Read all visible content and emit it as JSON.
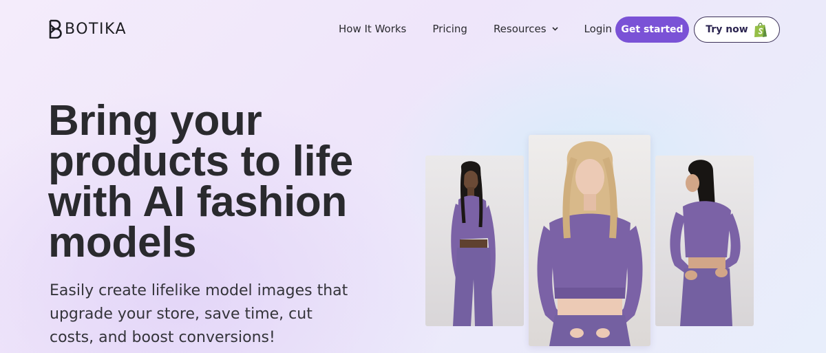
{
  "brand": {
    "name": "BOTIKA",
    "logo_icon": "botika-b-icon"
  },
  "nav": {
    "links": [
      {
        "label": "How It Works"
      },
      {
        "label": "Pricing"
      },
      {
        "label": "Resources",
        "icon": "chevron-down-icon"
      },
      {
        "label": "Login"
      }
    ],
    "cta_primary": "Get started",
    "cta_secondary": "Try now",
    "cta_secondary_icon": "shopify-bag-icon"
  },
  "hero": {
    "title_lines": [
      "Bring your",
      "products to life",
      "with AI fashion",
      "models"
    ],
    "subtitle": "Easily create lifelike model images that upgrade your store, save time, cut costs, and boost conversions!"
  },
  "gallery": {
    "images": [
      {
        "description_icon": "model-photo-dark-hair"
      },
      {
        "description_icon": "model-photo-blonde"
      },
      {
        "description_icon": "model-photo-back-view"
      }
    ]
  },
  "colors": {
    "accent": "#7a52d6",
    "outfit": "#7b62a6",
    "text": "#2a2a2e"
  }
}
